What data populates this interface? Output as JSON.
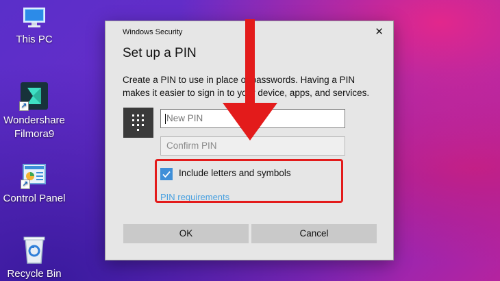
{
  "desktop": {
    "icons": [
      {
        "name": "This PC",
        "icon": "this-pc-icon"
      },
      {
        "name": "Wondershare Filmora9",
        "line1": "Wondershare",
        "line2": "Filmora9",
        "icon": "filmora-icon"
      },
      {
        "name": "Control Panel",
        "icon": "control-panel-icon"
      },
      {
        "name": "Recycle Bin",
        "icon": "recycle-bin-icon"
      }
    ]
  },
  "dialog": {
    "window_title": "Windows Security",
    "close_symbol": "✕",
    "heading": "Set up a PIN",
    "description_line1": "Create a PIN to use in place of passwords. Having a PIN",
    "description_line2": "makes it easier to sign in to your device, apps, and services.",
    "keypad_icon": "keypad-icon",
    "new_pin_placeholder": "New PIN",
    "confirm_pin_placeholder": "Confirm PIN",
    "include_letters_label": "Include letters and symbols",
    "include_letters_checked": true,
    "pin_requirements_link": "PIN requirements",
    "ok_label": "OK",
    "cancel_label": "Cancel"
  },
  "annotation": {
    "color": "#e31b1b",
    "arrow": "down-arrow-annotation",
    "box": "highlight-box"
  }
}
